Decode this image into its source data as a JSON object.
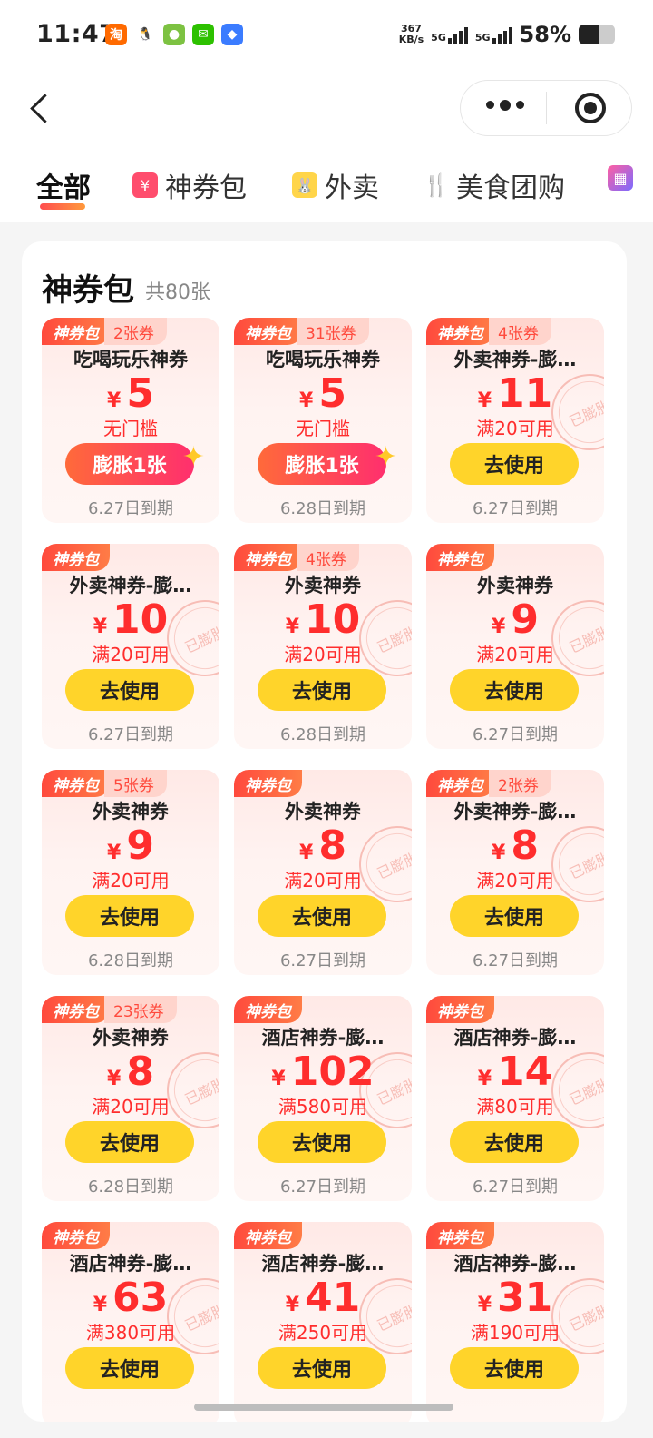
{
  "status": {
    "time": "11:47",
    "net_speed": "367",
    "net_unit": "KB/s",
    "sim1": "5G",
    "sim2": "5G",
    "battery": "58%",
    "battery_level": 0.58,
    "app_icons": [
      {
        "icon": "taobao-icon",
        "glyph": "淘",
        "color": "#ff6a00"
      },
      {
        "icon": "qq-icon",
        "glyph": "🐧",
        "color": "#ffffff"
      },
      {
        "icon": "app-icon",
        "glyph": "●",
        "color": "#7dc242"
      },
      {
        "icon": "wechat-icon",
        "glyph": "✉",
        "color": "#2dc100"
      },
      {
        "icon": "app-store-icon",
        "glyph": "◆",
        "color": "#3b7cff"
      }
    ]
  },
  "tabs": [
    {
      "label": "全部",
      "active": true,
      "icon": ""
    },
    {
      "label": "神券包",
      "active": false,
      "icon": "coupon-pack-icon"
    },
    {
      "label": "外卖",
      "active": false,
      "icon": "takeout-icon"
    },
    {
      "label": "美食团购",
      "active": false,
      "icon": "food-group-icon"
    },
    {
      "label": "",
      "active": false,
      "icon": "more-category-icon"
    }
  ],
  "section": {
    "title": "神券包",
    "count": "共80张",
    "badge_label": "神券包",
    "stamp_text": "已膨胀"
  },
  "coupons": [
    {
      "count": "2张券",
      "name": "吃喝玩乐神券",
      "yen": "¥",
      "amount": "5",
      "cond": "无门槛",
      "button": "膨胀1张",
      "expand": true,
      "expiry": "6.27日到期",
      "stamp": false
    },
    {
      "count": "31张券",
      "name": "吃喝玩乐神券",
      "yen": "¥",
      "amount": "5",
      "cond": "无门槛",
      "button": "膨胀1张",
      "expand": true,
      "expiry": "6.28日到期",
      "stamp": false
    },
    {
      "count": "4张券",
      "name": "外卖神券-膨…",
      "yen": "¥",
      "amount": "11",
      "cond": "满20可用",
      "button": "去使用",
      "expand": false,
      "expiry": "6.27日到期",
      "stamp": true
    },
    {
      "count": "",
      "name": "外卖神券-膨…",
      "yen": "¥",
      "amount": "10",
      "cond": "满20可用",
      "button": "去使用",
      "expand": false,
      "expiry": "6.27日到期",
      "stamp": true
    },
    {
      "count": "4张券",
      "name": "外卖神券",
      "yen": "¥",
      "amount": "10",
      "cond": "满20可用",
      "button": "去使用",
      "expand": false,
      "expiry": "6.28日到期",
      "stamp": true
    },
    {
      "count": "",
      "name": "外卖神券",
      "yen": "¥",
      "amount": "9",
      "cond": "满20可用",
      "button": "去使用",
      "expand": false,
      "expiry": "6.27日到期",
      "stamp": true
    },
    {
      "count": "5张券",
      "name": "外卖神券",
      "yen": "¥",
      "amount": "9",
      "cond": "满20可用",
      "button": "去使用",
      "expand": false,
      "expiry": "6.28日到期",
      "stamp": false
    },
    {
      "count": "",
      "name": "外卖神券",
      "yen": "¥",
      "amount": "8",
      "cond": "满20可用",
      "button": "去使用",
      "expand": false,
      "expiry": "6.27日到期",
      "stamp": true
    },
    {
      "count": "2张券",
      "name": "外卖神券-膨…",
      "yen": "¥",
      "amount": "8",
      "cond": "满20可用",
      "button": "去使用",
      "expand": false,
      "expiry": "6.27日到期",
      "stamp": true
    },
    {
      "count": "23张券",
      "name": "外卖神券",
      "yen": "¥",
      "amount": "8",
      "cond": "满20可用",
      "button": "去使用",
      "expand": false,
      "expiry": "6.28日到期",
      "stamp": true
    },
    {
      "count": "",
      "name": "酒店神券-膨…",
      "yen": "¥",
      "amount": "102",
      "cond": "满580可用",
      "button": "去使用",
      "expand": false,
      "expiry": "6.27日到期",
      "stamp": true
    },
    {
      "count": "",
      "name": "酒店神券-膨…",
      "yen": "¥",
      "amount": "14",
      "cond": "满80可用",
      "button": "去使用",
      "expand": false,
      "expiry": "6.27日到期",
      "stamp": true
    },
    {
      "count": "",
      "name": "酒店神券-膨…",
      "yen": "¥",
      "amount": "63",
      "cond": "满380可用",
      "button": "去使用",
      "expand": false,
      "expiry": "",
      "stamp": true
    },
    {
      "count": "",
      "name": "酒店神券-膨…",
      "yen": "¥",
      "amount": "41",
      "cond": "满250可用",
      "button": "去使用",
      "expand": false,
      "expiry": "",
      "stamp": true
    },
    {
      "count": "",
      "name": "酒店神券-膨…",
      "yen": "¥",
      "amount": "31",
      "cond": "满190可用",
      "button": "去使用",
      "expand": false,
      "expiry": "",
      "stamp": true
    }
  ]
}
